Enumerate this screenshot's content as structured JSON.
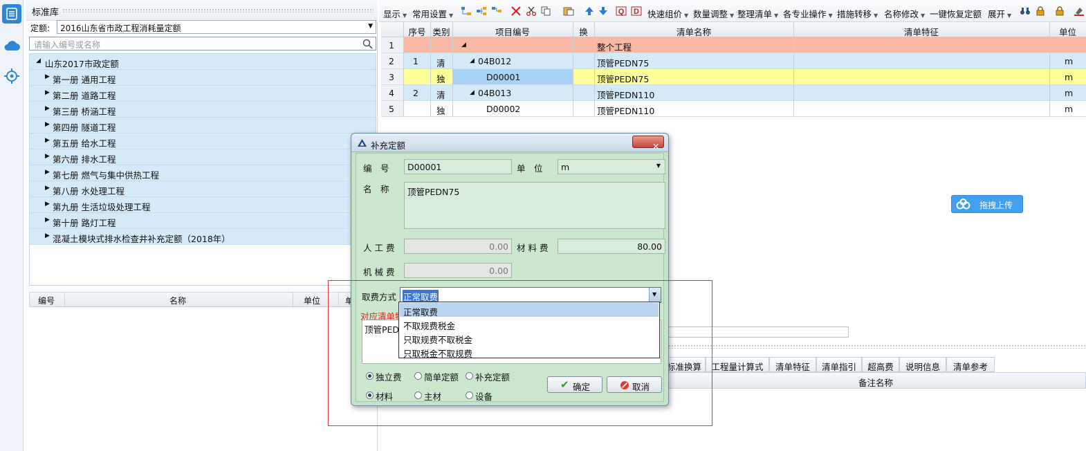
{
  "library": {
    "title": "标准库",
    "quota_label": "定额:",
    "quota_value": "2016山东省市政工程消耗量定额",
    "search_placeholder": "请输入编号或名称",
    "tree_root": "山东2017市政定额",
    "tree_items": [
      "第一册 通用工程",
      "第二册 道路工程",
      "第三册 桥涵工程",
      "第四册 隧道工程",
      "第五册 给水工程",
      "第六册 排水工程",
      "第七册 燃气与集中供热工程",
      "第八册 水处理工程",
      "第九册 生活垃圾处理工程",
      "第十册 路灯工程",
      "混凝土模块式排水检查井补充定额（2018年）"
    ],
    "sub_columns": [
      "编号",
      "名称",
      "单位",
      "单"
    ]
  },
  "toolbar": {
    "items": [
      "显示",
      "常用设置",
      "快速组价",
      "数量调整",
      "整理清单",
      "各专业操作",
      "措施转移",
      "名称修改",
      "一键恢复定额",
      "展开"
    ]
  },
  "grid": {
    "columns": [
      "序号",
      "类别",
      "项目编号",
      "换",
      "清单名称",
      "清单特征",
      "单位"
    ],
    "rows": [
      {
        "row": "1",
        "seq": "",
        "type": "",
        "code": "",
        "name": "整个工程",
        "unit": ""
      },
      {
        "row": "2",
        "seq": "1",
        "type": "清",
        "code": "04B012",
        "name": "顶管PEDN75",
        "unit": "m"
      },
      {
        "row": "3",
        "seq": "",
        "type": "独",
        "code": "D00001",
        "name": "顶管PEDN75",
        "unit": "m"
      },
      {
        "row": "4",
        "seq": "2",
        "type": "清",
        "code": "04B013",
        "name": "顶管PEDN110",
        "unit": "m"
      },
      {
        "row": "5",
        "seq": "",
        "type": "独",
        "code": "D00002",
        "name": "顶管PEDN110",
        "unit": "m"
      }
    ]
  },
  "upload_button": "拖拽上传",
  "lower_tabs": [
    "标准换算",
    "工程量计算式",
    "清单特征",
    "清单指引",
    "超高费",
    "说明信息",
    "清单参考"
  ],
  "remark_header": "备注名称",
  "dialog": {
    "title": "补充定额",
    "code_label": "编　号",
    "code_value": "D00001",
    "unit_label": "单　位",
    "unit_value": "m",
    "name_label": "名　称",
    "name_value": "顶管PEDN75",
    "labor_label": "人 工 费",
    "labor_value": "0.00",
    "material_label": "材 料 费",
    "material_value": "80.00",
    "machine_label": "机 械 费",
    "machine_value": "0.00",
    "fee_label": "取费方式",
    "fee_value": "正常取费",
    "fee_options": [
      "正常取费",
      "不取规费税金",
      "只取规费不取税金",
      "只取税金不取规费"
    ],
    "linked_label": "对应清单特",
    "linked_value": "顶管PEDN",
    "radio_group1": [
      "独立费",
      "简单定额",
      "补充定额"
    ],
    "radio_group2": [
      "材料",
      "主材",
      "设备"
    ],
    "ok_label": "确定",
    "cancel_label": "取消"
  },
  "colors": {
    "tree_bg": "#d5eaf9",
    "row_project": "#f8b8a4",
    "row_list": "#d5eaf9",
    "row_selected": "#ffff99",
    "dialog_bg": "#c4e4c8",
    "highlight_box": "#e0343a"
  }
}
